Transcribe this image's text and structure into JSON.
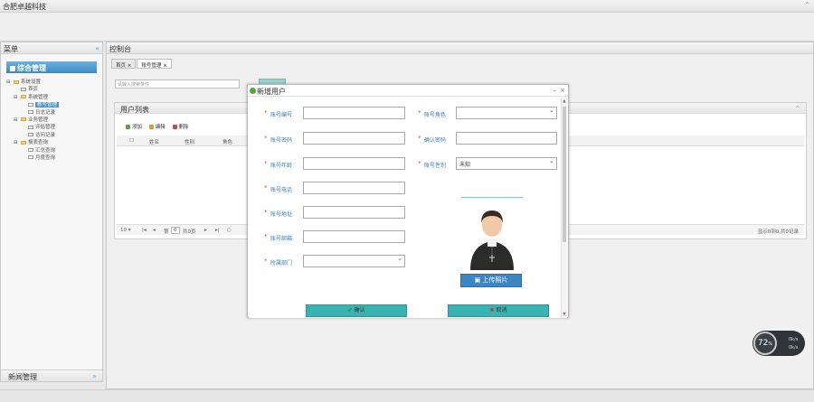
{
  "app": {
    "title": "合肥卓越科技"
  },
  "sidebar": {
    "header": "菜单",
    "section_title": "综合管理",
    "tree": [
      {
        "label": "系统设置",
        "type": "folder",
        "level": 0
      },
      {
        "label": "首页",
        "type": "doc",
        "level": 1
      },
      {
        "label": "系统管理",
        "type": "folder",
        "level": 1
      },
      {
        "label": "账号管理",
        "type": "doc",
        "level": 2,
        "selected": true
      },
      {
        "label": "日志记录",
        "type": "doc",
        "level": 2
      },
      {
        "label": "业务管理",
        "type": "folder",
        "level": 1
      },
      {
        "label": "评估管理",
        "type": "doc",
        "level": 2
      },
      {
        "label": "访问记录",
        "type": "doc",
        "level": 2
      },
      {
        "label": "报表查询",
        "type": "folder",
        "level": 1
      },
      {
        "label": "汇总查询",
        "type": "doc",
        "level": 2
      },
      {
        "label": "月度查询",
        "type": "doc",
        "level": 2
      }
    ],
    "bottom_section": "新闻管理"
  },
  "main": {
    "header": "控制台",
    "tabs": [
      {
        "label": "首页 ×"
      },
      {
        "label": "账号管理 ×"
      }
    ],
    "search_placeholder": "请输入搜索条件",
    "panel_title": "用户列表",
    "toolbar": [
      "添加",
      "编辑",
      "删除"
    ],
    "columns": [
      "姓名",
      "性别",
      "角色"
    ],
    "pager": {
      "page_size": "10",
      "page_label": "第",
      "page_value": "0",
      "page_total": "共0页",
      "summary": "显示0到0,共0记录"
    }
  },
  "dialog": {
    "title": "新增用户",
    "fields_left": [
      {
        "label": "账号编号",
        "value": ""
      },
      {
        "label": "账号密码",
        "value": ""
      },
      {
        "label": "账号年龄",
        "value": ""
      },
      {
        "label": "账号电话",
        "value": ""
      },
      {
        "label": "账号地址",
        "value": ""
      },
      {
        "label": "账号邮箱",
        "value": ""
      },
      {
        "label": "所属部门",
        "value": "",
        "select": true
      }
    ],
    "fields_right": [
      {
        "label": "账号角色",
        "value": "",
        "select": true
      },
      {
        "label": "确认密码",
        "value": ""
      },
      {
        "label": "账号性别",
        "value": "未知",
        "select": true
      }
    ],
    "upload_label": "上传照片",
    "ok_label": "确认",
    "cancel_label": "取消"
  },
  "widget": {
    "value": "72",
    "unit": "%",
    "up": "0k/s",
    "down": "0k/s"
  },
  "colors": {
    "accent": "#3d86c6",
    "teal": "#39b3b1",
    "title_blue": "#3e8ac4"
  }
}
